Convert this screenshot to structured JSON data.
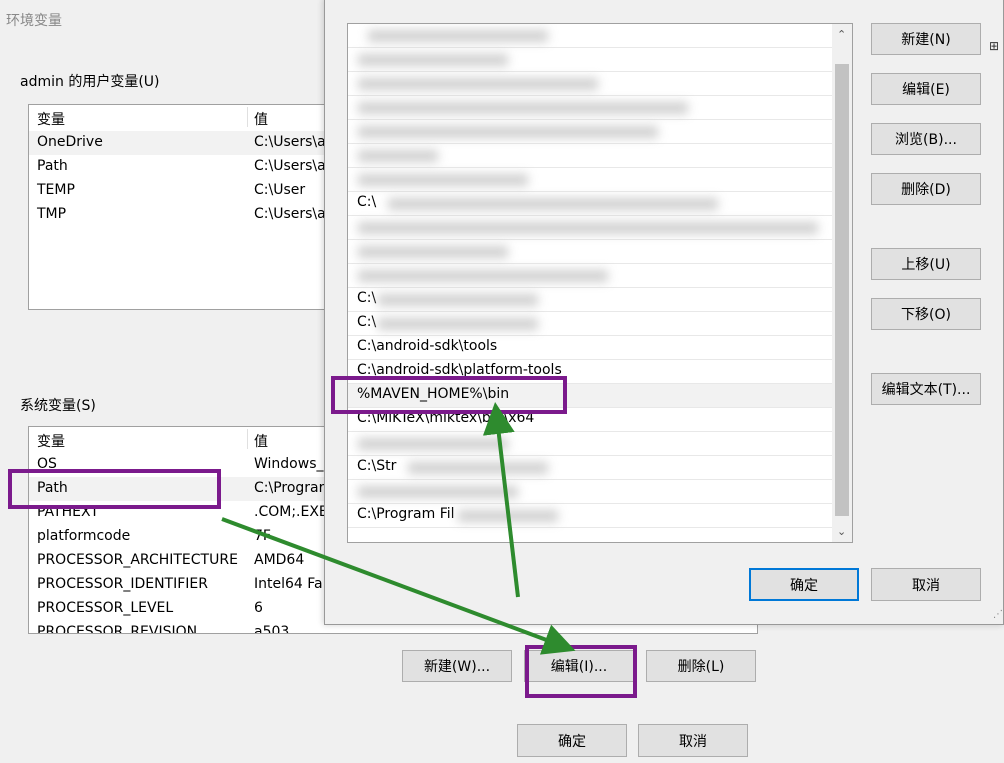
{
  "back_window": {
    "title": "环境变量",
    "user_group_label": "admin 的用户变量(U)",
    "user_table": {
      "headers": [
        "变量",
        "值"
      ],
      "rows": [
        {
          "name": "OneDrive",
          "value": "C:\\Users\\a"
        },
        {
          "name": "Path",
          "value": "C:\\Users\\a"
        },
        {
          "name": "TEMP",
          "value": "C:\\User"
        },
        {
          "name": "TMP",
          "value": "C:\\Users\\a"
        }
      ]
    },
    "system_group_label": "系统变量(S)",
    "system_table": {
      "headers": [
        "变量",
        "值"
      ],
      "rows": [
        {
          "name": "OS",
          "value": "Windows_"
        },
        {
          "name": "Path",
          "value": "C:\\Prograr"
        },
        {
          "name": "PATHEXT",
          "value": ".COM;.EXE"
        },
        {
          "name": "platformcode",
          "value": "7F"
        },
        {
          "name": "PROCESSOR_ARCHITECTURE",
          "value": "AMD64"
        },
        {
          "name": "PROCESSOR_IDENTIFIER",
          "value": "Intel64 Fa"
        },
        {
          "name": "PROCESSOR_LEVEL",
          "value": "6"
        },
        {
          "name": "PROCESSOR_REVISION",
          "value": "a503"
        }
      ]
    },
    "buttons": {
      "new": "新建(W)...",
      "edit": "编辑(I)...",
      "delete": "删除(L)",
      "ok": "确定",
      "cancel": "取消"
    }
  },
  "edit_dialog": {
    "path_entries": [
      "%SystemRoot%\\system32",
      "%SystemRoot%",
      "%SystemRoot%\\System32\\Wbem",
      "%SYSTEMROOT%\\System32\\WindowsPowerShell\\v1.0\\",
      "%SYSTEMROOT%\\System32\\OpenSSH\\",
      "C:\\Program Files\\Git\\cmd",
      "C:\\Program Files\\nodejs\\",
      "C:\\Program Files (x86)\\NVIDIA Corporation\\PhysX\\Common",
      "C:\\Program Files\\dotnet\\",
      "C:\\Program Files\\Java\\jdk\\bin",
      "C:\\Python\\Scripts\\",
      "C:\\Program Files\\MySQL\\MySQL Server\\bin",
      "C:\\android-sdk\\tools",
      "C:\\android-sdk\\platform-tools",
      "%MAVEN_HOME%\\bin",
      "C:\\MiKTeX\\miktex\\bin\\x64",
      "C:\\Strawberry\\c\\bin",
      "C:\\Strawberry\\perl\\site\\bin",
      "C:\\Strawberry\\perl\\bin",
      "C:\\Program Files (x86)\\PuTTY\\"
    ],
    "visible_entries": {
      "e13": "C:\\android-sdk\\tools",
      "e14": "C:\\android-sdk\\platform-tools",
      "e15": "%MAVEN_HOME%\\bin",
      "e16": "C:\\MiKTeX\\miktex\\bin\\x64",
      "e11": "C:\\",
      "e10": "C:\\",
      "e6": "C:\\",
      "e9": "C:\\",
      "e17": "C:\\Str",
      "e19": "C:\\Program Fil"
    },
    "buttons": {
      "new": "新建(N)",
      "edit": "编辑(E)",
      "browse": "浏览(B)...",
      "delete": "删除(D)",
      "move_up": "上移(U)",
      "move_down": "下移(O)",
      "edit_text": "编辑文本(T)...",
      "ok": "确定",
      "cancel": "取消"
    }
  },
  "annotations": {
    "highlight_color": "#7b1a8c",
    "arrow_color": "#2e8b2e"
  }
}
